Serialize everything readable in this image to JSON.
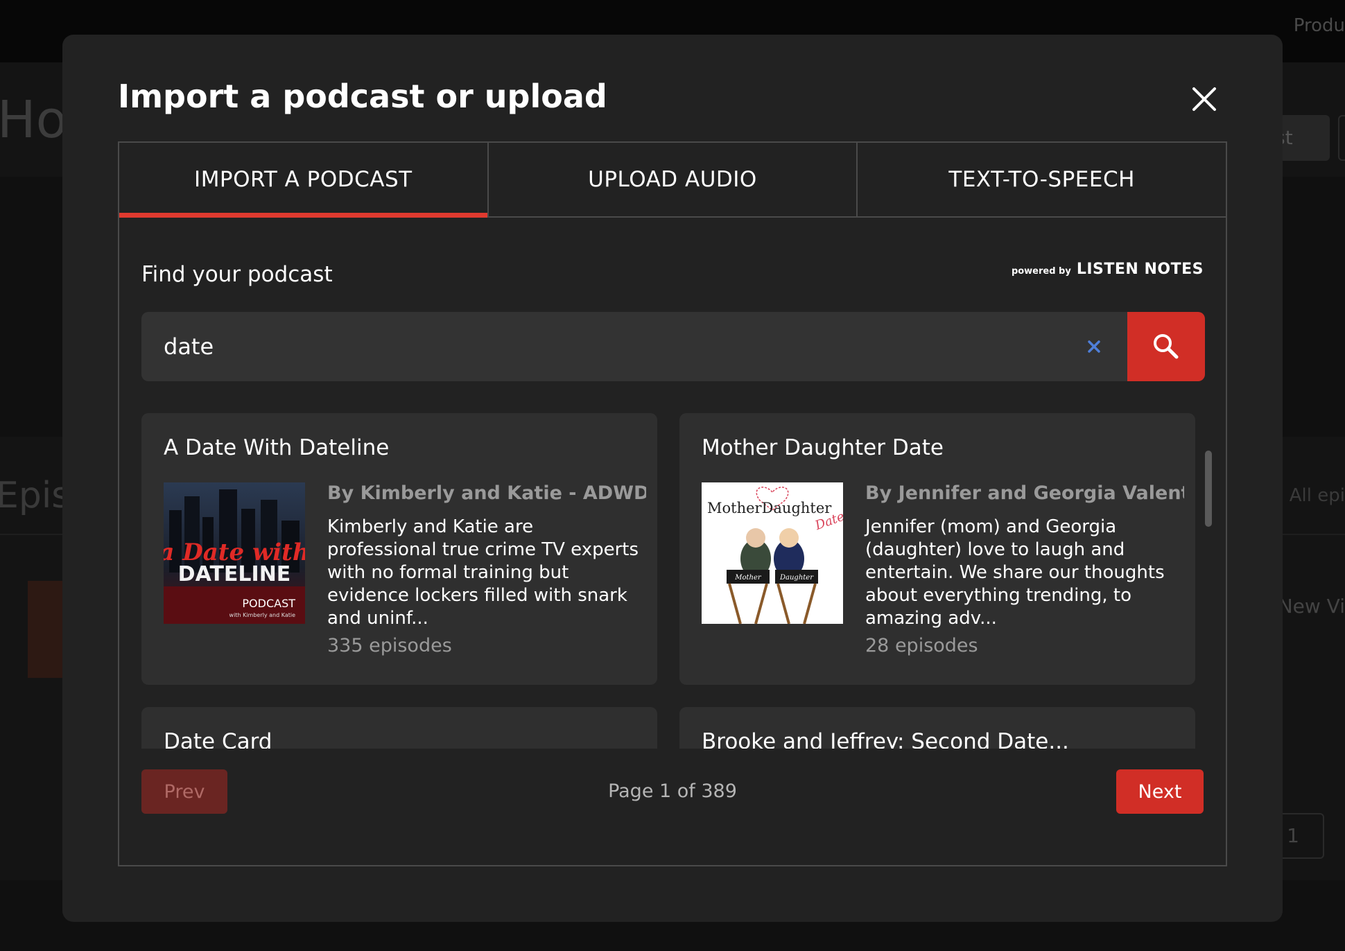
{
  "background": {
    "topbar_link": "Produ",
    "page_title": "Ho",
    "header_button": "ast",
    "section_title": "Episo",
    "filter_label": "All epi",
    "new_label": "New Vi",
    "page_number": "1"
  },
  "modal": {
    "title": "Import a podcast or upload",
    "tabs": [
      {
        "label": "IMPORT A PODCAST",
        "active": true
      },
      {
        "label": "UPLOAD AUDIO",
        "active": false
      },
      {
        "label": "TEXT-TO-SPEECH",
        "active": false
      }
    ],
    "find_label": "Find your podcast",
    "powered_by": {
      "small": "powered by",
      "brand": "LISTEN NOTES"
    },
    "search": {
      "value": "date",
      "placeholder": ""
    },
    "results": [
      {
        "title": "A Date With Dateline",
        "author": "By Kimberly and Katie - ADWDL",
        "description": "Kimberly and Katie are professional true crime TV experts with no formal training but evidence lockers filled with snark and uninf...",
        "episodes": "335 episodes",
        "art": {
          "line1": "a Date with",
          "line2": "DATELINE",
          "line3": "PODCAST",
          "line4": "with Kimberly and Katie"
        }
      },
      {
        "title": "Mother Daughter Date",
        "author": "By Jennifer and Georgia Valent...",
        "description": "Jennifer (mom) and Georgia (daughter) love to laugh and entertain. We share our thoughts about everything trending, to amazing adv...",
        "episodes": "28 episodes",
        "art": {
          "line1": "MotherDaughter",
          "line2": "Date",
          "chair1": "Mother",
          "chair2": "Daughter"
        }
      },
      {
        "title": "Date Card"
      },
      {
        "title": "Brooke and Jeffrey: Second Date..."
      }
    ],
    "pagination": {
      "prev": "Prev",
      "info": "Page 1 of 389",
      "next": "Next"
    }
  },
  "colors": {
    "accent": "#d12e26",
    "tab_indicator": "#e03a2f",
    "modal_bg": "#222222",
    "card_bg": "#2f2f2f"
  }
}
